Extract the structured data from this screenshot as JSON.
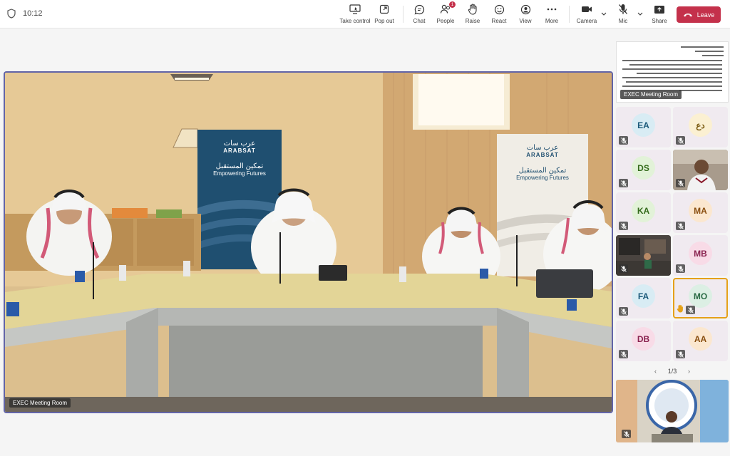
{
  "toolbar": {
    "time": "10:12",
    "buttons": {
      "take_control": "Take control",
      "pop_out": "Pop out",
      "chat": "Chat",
      "people": "People",
      "people_badge": "1",
      "raise": "Raise",
      "react": "React",
      "view": "View",
      "more": "More",
      "camera": "Camera",
      "mic": "Mic",
      "share": "Share",
      "leave": "Leave"
    }
  },
  "main_video": {
    "name": "EXEC Meeting Room",
    "banner_left": {
      "arabic": "عرب سات",
      "brand": "ARABSAT",
      "tagline_ar": "تمكين المستقبل",
      "tagline_en": "Empowering Futures"
    },
    "banner_right": {
      "arabic": "عرب سات",
      "brand": "ARABSAT",
      "tagline_ar": "تمكين المستقبل",
      "tagline_en": "Empowering Futures"
    }
  },
  "shared_content": {
    "name": "EXEC Meeting Room"
  },
  "participants": [
    {
      "initials": "EA",
      "bg": "#d8ecf4",
      "fg": "#1b5a7a",
      "muted": true
    },
    {
      "initials": "دع",
      "bg": "#fbf0d2",
      "fg": "#7a5a10",
      "muted": true
    },
    {
      "initials": "DS",
      "bg": "#e2f2d8",
      "fg": "#356b1c",
      "muted": true
    },
    {
      "initials": "",
      "video": true,
      "muted": true
    },
    {
      "initials": "KA",
      "bg": "#e2f2d8",
      "fg": "#356b1c",
      "muted": true
    },
    {
      "initials": "MA",
      "bg": "#fbe7cf",
      "fg": "#8a4f10",
      "muted": true
    },
    {
      "initials": "",
      "video": true,
      "muted": true
    },
    {
      "initials": "MB",
      "bg": "#f8dbe7",
      "fg": "#8a2350",
      "muted": true
    },
    {
      "initials": "FA",
      "bg": "#d8ecf4",
      "fg": "#1b5a7a",
      "muted": true
    },
    {
      "initials": "MO",
      "bg": "#dcefe4",
      "fg": "#2a6b45",
      "muted": true,
      "hand_raised": true,
      "active": true
    },
    {
      "initials": "DB",
      "bg": "#f8dbe7",
      "fg": "#8a2350",
      "muted": true
    },
    {
      "initials": "AA",
      "bg": "#fbe7cf",
      "fg": "#8a4f10",
      "muted": true
    }
  ],
  "pager": {
    "label": "1/3"
  },
  "colors": {
    "accent": "#6264a7",
    "leave": "#c4314b",
    "raised_hand": "#e5a118"
  }
}
